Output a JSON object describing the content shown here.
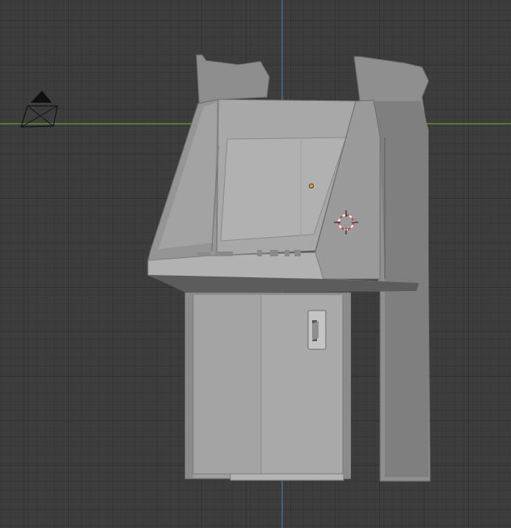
{
  "viewport": {
    "view": "front-orthographic",
    "grid": true,
    "axes": {
      "x_axis_color": "#6a9a2a",
      "z_axis_color": "#3f77a8"
    },
    "background": "#3d3d3d",
    "grid_color": "#2f2f2f"
  },
  "scene": {
    "selected_object": "arcade-cabinet",
    "objects": [
      {
        "name": "arcade-cabinet",
        "kind": "mesh",
        "color": "#a2a2a2"
      },
      {
        "name": "camera",
        "kind": "camera",
        "color": "#111111"
      },
      {
        "name": "3d-cursor",
        "kind": "cursor",
        "color": "#e23a3a"
      },
      {
        "name": "object-origin",
        "kind": "origin",
        "color": "#f09a1c"
      }
    ]
  }
}
